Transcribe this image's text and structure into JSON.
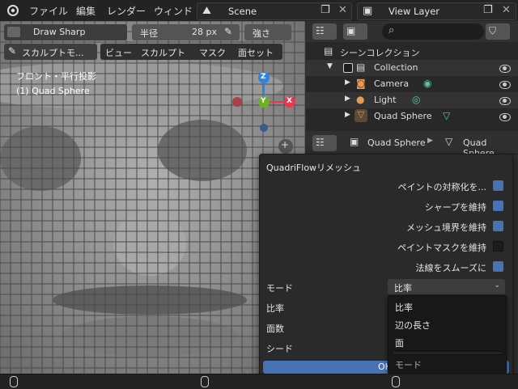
{
  "topbar": {
    "menus": [
      "ファイル",
      "編集",
      "レンダー",
      "ウィンド"
    ],
    "scene": "Scene",
    "view_layer": "View Layer"
  },
  "tool_header": {
    "brush": "Draw Sharp",
    "radius_label": "半径",
    "radius_value": "28 px",
    "strength_label": "強さ",
    "mode": "スカルプトモ...",
    "menus": [
      "ビュー",
      "スカルプト",
      "マスク",
      "面セット"
    ]
  },
  "viewport": {
    "view_name": "フロント・平行投影",
    "object_name": "(1) Quad Sphere",
    "gizmo": {
      "z": "Z",
      "y": "Y",
      "x": "X"
    }
  },
  "outliner": {
    "title": "シーンコレクション",
    "items": [
      {
        "label": "Collection"
      },
      {
        "label": "Camera"
      },
      {
        "label": "Light"
      },
      {
        "label": "Quad Sphere"
      }
    ]
  },
  "properties": {
    "object": "Quad Sphere",
    "mesh": "Quad Sphere"
  },
  "dialog": {
    "title": "QuadriFlowリメッシュ",
    "options": [
      {
        "label": "ペイントの対称化を...",
        "checked": true
      },
      {
        "label": "シャープを維持",
        "checked": true
      },
      {
        "label": "メッシュ境界を維持",
        "checked": true
      },
      {
        "label": "ペイントマスクを維持",
        "checked": false
      },
      {
        "label": "法線をスムーズに",
        "checked": true
      }
    ],
    "mode_label": "モード",
    "mode_value": "比率",
    "field_labels": [
      "比率",
      "面数",
      "シード"
    ],
    "dropdown_options": [
      "比率",
      "辺の長さ",
      "面"
    ],
    "dropdown_header": "モード",
    "ok": "OK"
  },
  "colors": {
    "accent": "#4772b3",
    "x_axis": "#e8374f",
    "y_axis": "#6ab21f",
    "z_axis": "#2f83e3"
  }
}
